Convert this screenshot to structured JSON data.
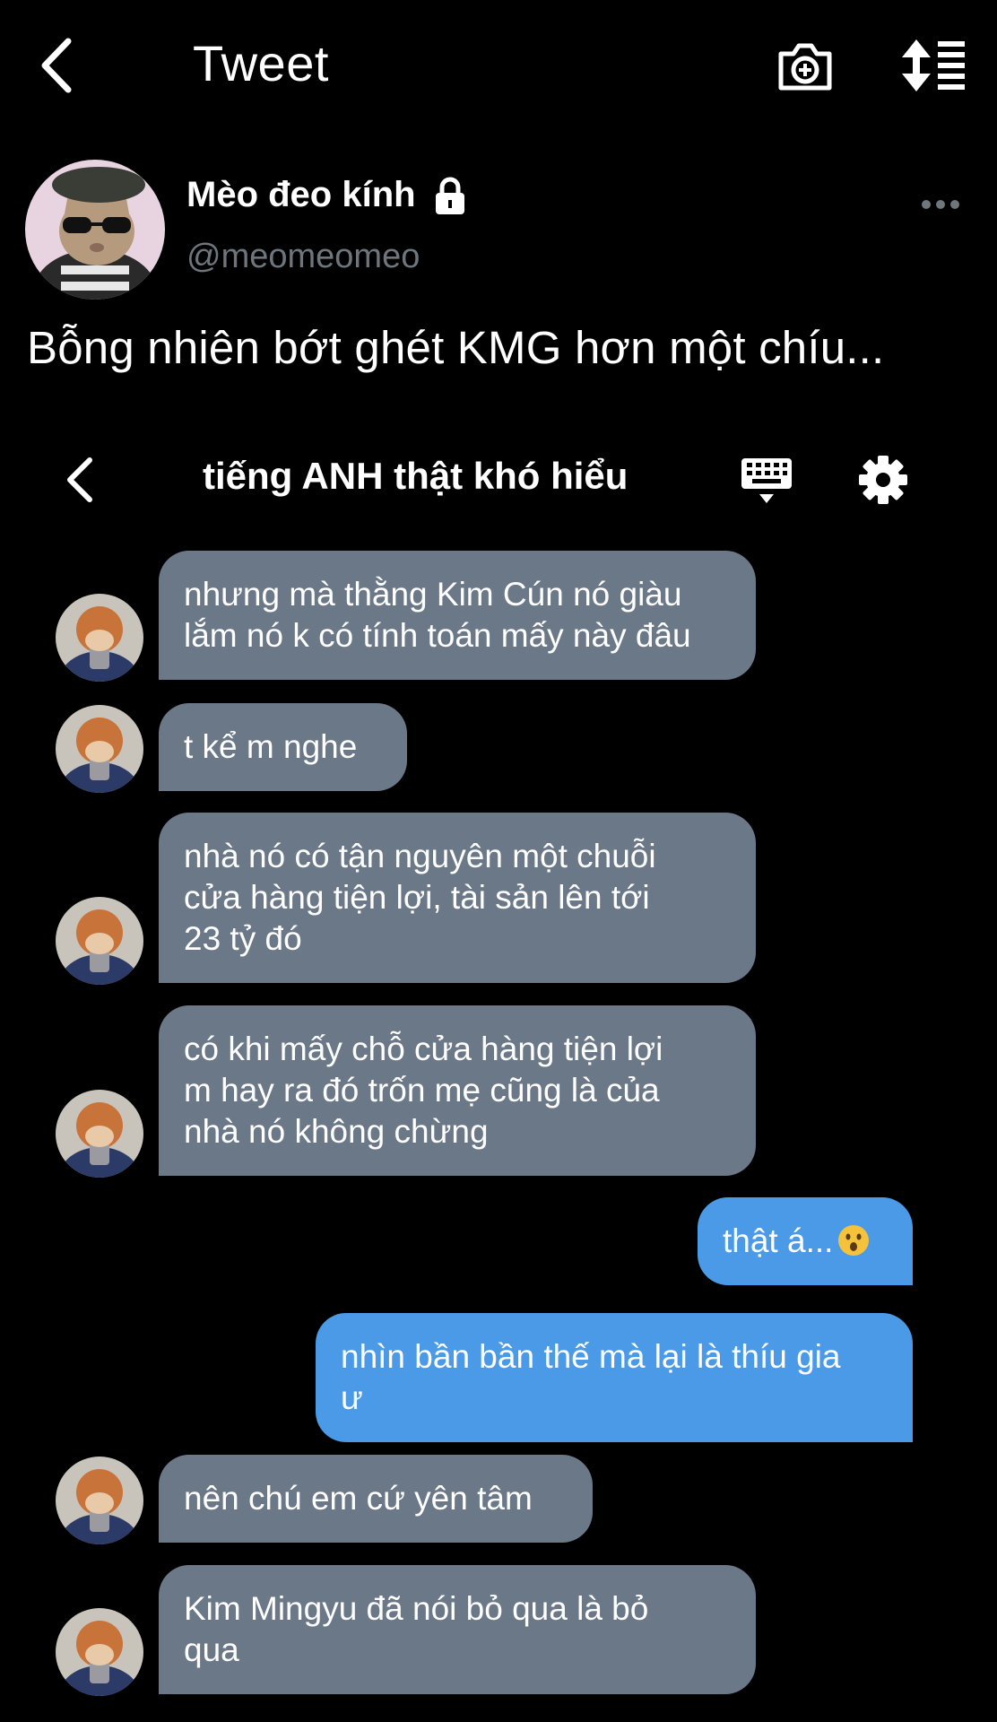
{
  "topbar": {
    "title": "Tweet",
    "icons": [
      "back-icon",
      "camera-plus-icon",
      "sort-icon"
    ]
  },
  "author": {
    "name": "Mèo đeo kính",
    "handle": "@meomeomeo",
    "locked": true,
    "avatar": "cat-with-sunglasses"
  },
  "tweet": {
    "text": "Bỗng nhiên bớt ghét KMG hơn một chíu..."
  },
  "chat": {
    "title": "tiếng ANH thật khó hiểu",
    "icons": [
      "back-icon",
      "keyboard-icon",
      "gear-icon"
    ],
    "messages": [
      {
        "side": "in",
        "lines": [
          "nhưng mà thằng Kim Cún nó giàu",
          "lắm nó k có tính toán mấy này đâu"
        ]
      },
      {
        "side": "in",
        "lines": [
          "t kể m nghe"
        ]
      },
      {
        "side": "in",
        "lines": [
          "nhà nó có tận nguyên một chuỗi",
          "cửa hàng tiện lợi, tài sản lên tới",
          "23 tỷ đó"
        ]
      },
      {
        "side": "in",
        "lines": [
          "có khi mấy chỗ cửa hàng tiện lợi",
          "m hay ra đó trốn mẹ cũng là của",
          "nhà nó không chừng"
        ]
      },
      {
        "side": "out",
        "lines": [
          "thật á..."
        ],
        "emoji": "surprised-face"
      },
      {
        "side": "out",
        "lines": [
          "nhìn bần bần thế mà lại là thíu gia",
          "ư"
        ]
      },
      {
        "side": "in",
        "lines": [
          "nên chú em cứ yên tâm"
        ]
      },
      {
        "side": "in",
        "lines": [
          "Kim Mingyu đã nói bỏ qua là bỏ",
          "qua"
        ]
      }
    ]
  },
  "colors": {
    "background": "#000000",
    "incoming_bubble": "#6b7888",
    "outgoing_bubble": "#4a9ae8",
    "handle_gray": "#6e767d"
  }
}
